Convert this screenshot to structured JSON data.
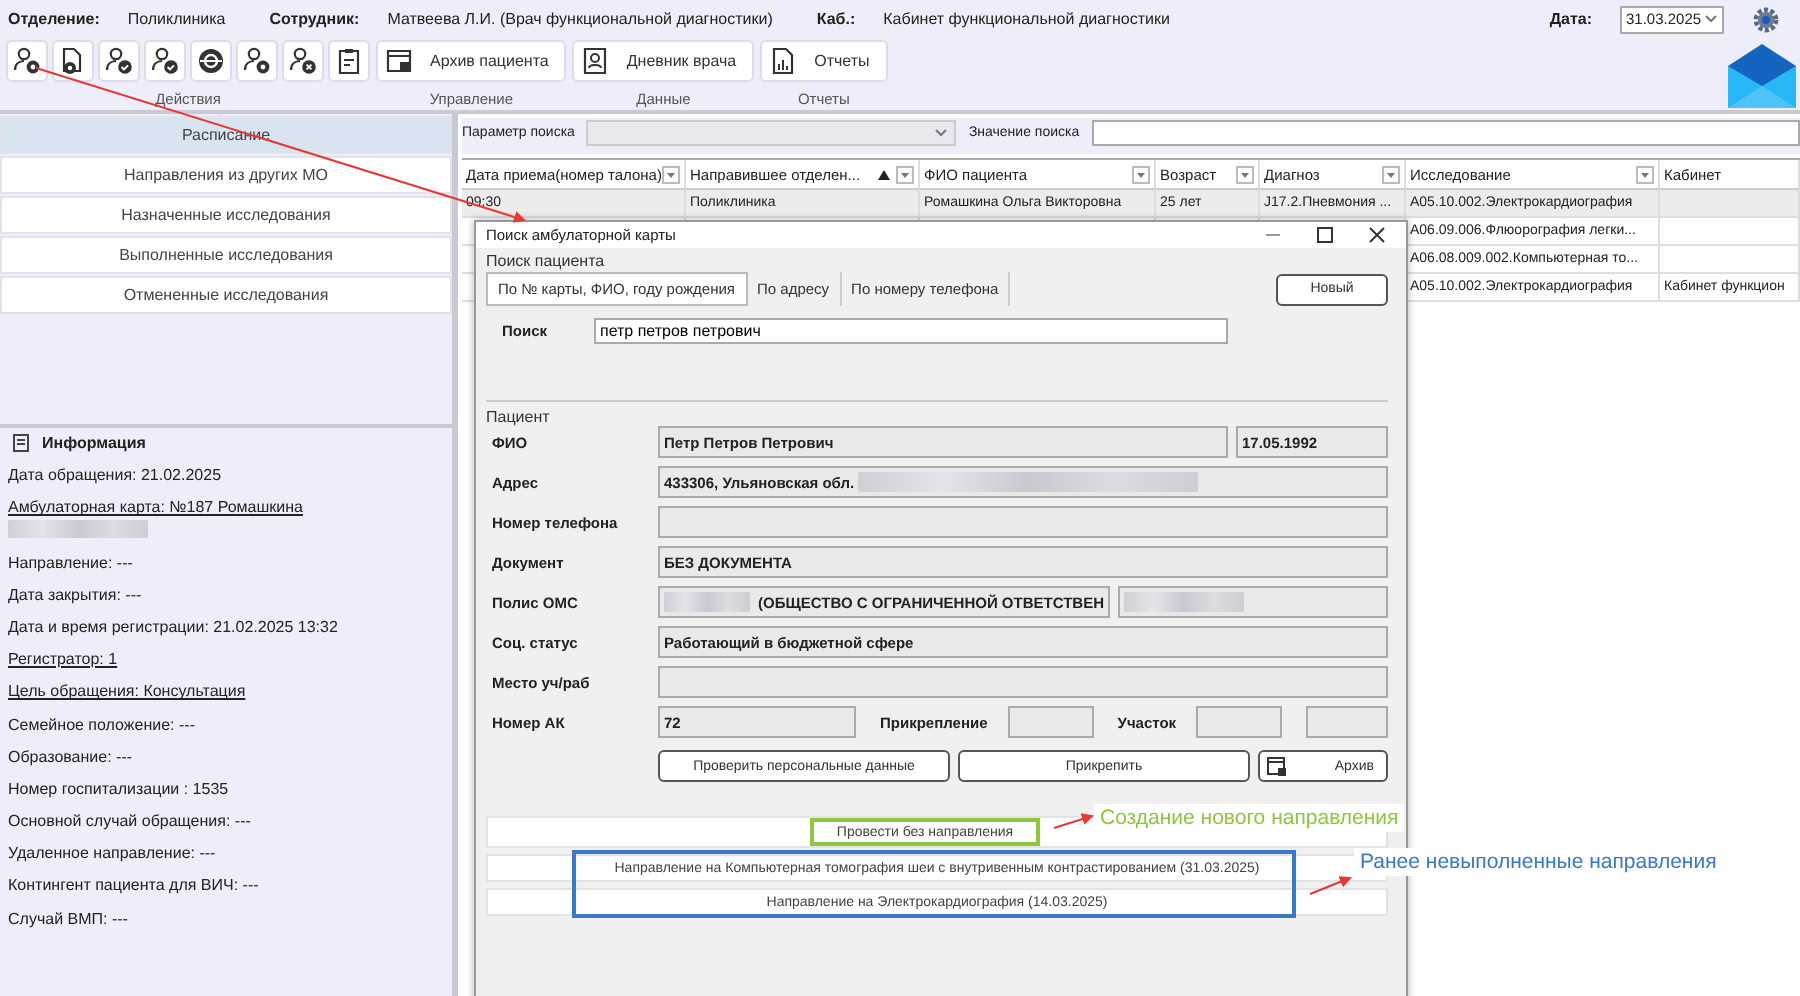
{
  "header": {
    "fields": [
      {
        "label": "Отделение:",
        "value": "Поликлиника"
      },
      {
        "label": "Сотрудник:",
        "value": "Матвеева Л.И. (Врач функциональной диагностики)"
      },
      {
        "label": "Каб.:",
        "value": "Кабинет функциональной диагностики"
      }
    ],
    "date_label": "Дата:",
    "date_value": "31.03.2025"
  },
  "toolbar": [
    {
      "label": "Действия",
      "buttons": [
        {
          "kind": "icon"
        },
        {
          "kind": "icon"
        },
        {
          "kind": "icon"
        },
        {
          "kind": "icon"
        },
        {
          "kind": "icon"
        },
        {
          "kind": "icon"
        },
        {
          "kind": "icon"
        },
        {
          "kind": "icon"
        }
      ]
    },
    {
      "label": "Управление",
      "buttons": [
        {
          "kind": "icon-text",
          "label": "Архив пациента"
        }
      ]
    },
    {
      "label": "Данные",
      "buttons": [
        {
          "kind": "icon-text",
          "label": "Дневник врача"
        }
      ]
    },
    {
      "label": "Отчеты",
      "buttons": [
        {
          "kind": "icon-text",
          "label": "Отчеты"
        }
      ]
    }
  ],
  "sidebar": {
    "items": [
      {
        "label": "Расписание",
        "selected": true
      },
      {
        "label": "Направления из других МО",
        "selected": false
      },
      {
        "label": "Назначенные исследования",
        "selected": false
      },
      {
        "label": "Выполненные исследования",
        "selected": false
      },
      {
        "label": "Отмененные исследования",
        "selected": false
      }
    ]
  },
  "info": {
    "title": "Информация",
    "items": [
      {
        "text": "Дата обращения: 21.02.2025",
        "link": false
      },
      {
        "text": "Амбулаторная карта: №187 Ромашкина",
        "link": true
      },
      {
        "text": "Направление: ---",
        "link": false
      },
      {
        "text": "Дата закрытия: ---",
        "link": false
      },
      {
        "text": "Дата и время регистрации: 21.02.2025 13:32",
        "link": false
      },
      {
        "text": "Регистратор: 1",
        "link": true
      },
      {
        "text": "Цель обращения: Консультация",
        "link": true
      },
      {
        "text": "Семейное положение: ---",
        "link": false
      },
      {
        "text": "Образование: ---",
        "link": false
      },
      {
        "text": "Номер госпитализации : 1535",
        "link": false
      },
      {
        "text": "Основной случай обращения: ---",
        "link": false
      },
      {
        "text": "Удаленное направление: ---",
        "link": false
      },
      {
        "text": "Контингент пациента для ВИЧ: ---",
        "link": false
      },
      {
        "text": "Случай ВМП: ---",
        "link": false
      }
    ]
  },
  "search": {
    "param_label": "Параметр поиска",
    "value_label": "Значение поиска"
  },
  "table": {
    "columns": [
      {
        "label": "Дата приема(номер талона)",
        "sorted": false
      },
      {
        "label": "Направившее  отделен...",
        "sorted": true
      },
      {
        "label": "ФИО пациента",
        "sorted": false
      },
      {
        "label": "Возраст",
        "sorted": false
      },
      {
        "label": "Диагноз",
        "sorted": false
      },
      {
        "label": "Исследование",
        "sorted": false
      },
      {
        "label": "Кабинет",
        "sorted": false
      }
    ],
    "rows": [
      {
        "selected": true,
        "cells": [
          "09:30",
          "Поликлиника",
          "Ромашкина Ольга Викторовна",
          "25 лет",
          "J17.2.Пневмония ...",
          "A05.10.002.Электрокардиография",
          ""
        ]
      },
      {
        "selected": false,
        "cells": [
          "",
          "",
          "",
          "",
          "",
          "A06.09.006.Флюорография  легки...",
          ""
        ]
      },
      {
        "selected": false,
        "cells": [
          "",
          "",
          "",
          "",
          "",
          "A06.08.009.002.Компьютерная  то...",
          ""
        ]
      },
      {
        "selected": false,
        "cells": [
          "",
          "",
          "",
          "",
          "",
          "A05.10.002.Электрокардиография",
          "Кабинет функцион"
        ]
      }
    ]
  },
  "dialog": {
    "title": "Поиск амбулаторной карты",
    "search_group": "Поиск пациента",
    "tabs": [
      {
        "label": "По № карты, ФИО, году рождения",
        "selected": true
      },
      {
        "label": "По адресу",
        "selected": false
      },
      {
        "label": "По номеру телефона",
        "selected": false
      }
    ],
    "new_button": "Новый",
    "search_label": "Поиск",
    "search_value": "петр петров петрович",
    "patient_group": "Пациент",
    "rows": [
      {
        "label": "ФИО",
        "cells": [
          {
            "kind": "field",
            "value": "Петр Петров Петрович"
          },
          {
            "kind": "date",
            "value": "17.05.1992"
          }
        ]
      },
      {
        "label": "Адрес",
        "cells": [
          {
            "kind": "field",
            "value": "433306, Ульяновская обл."
          }
        ]
      },
      {
        "label": "Номер телефона",
        "cells": [
          {
            "kind": "field"
          }
        ]
      },
      {
        "label": "Документ",
        "cells": [
          {
            "kind": "field",
            "value": "БЕЗ ДОКУМЕНТА"
          }
        ]
      },
      {
        "label": "Полис ОМС",
        "cells": [
          {
            "kind": "policy",
            "value": "(ОБЩЕСТВО С ОГРАНИЧЕННОЙ ОТВЕТСТВЕН"
          },
          {
            "kind": "field"
          }
        ]
      },
      {
        "label": "Соц. статус",
        "cells": [
          {
            "kind": "field",
            "value": "Работающий в бюджетной сфере"
          }
        ]
      },
      {
        "label": "Место уч/раб",
        "cells": [
          {
            "kind": "field"
          }
        ]
      },
      {
        "label": "Номер АК",
        "cells": [
          {
            "kind": "ak",
            "value": "72"
          },
          {
            "kind": "label",
            "text": "Прикрепление"
          },
          {
            "kind": "narrow"
          },
          {
            "kind": "label",
            "text": "Участок"
          },
          {
            "kind": "narrow"
          },
          {
            "kind": "field"
          }
        ]
      }
    ],
    "buttons": [
      {
        "kind": "text",
        "label": "Проверить персональные данные"
      },
      {
        "kind": "text",
        "label": "Прикрепить"
      },
      {
        "kind": "icon-text",
        "label": "Архив"
      }
    ],
    "create_button": "Провести без направления",
    "directions": [
      "Направление на Компьютерная томография шеи с внутривенным контрастированием (31.03.2025)",
      "Направление на Электрокардиография (14.03.2025)"
    ]
  },
  "annotations": [
    {
      "text": "Создание нового направления",
      "color": "#8dc63f"
    },
    {
      "text": "Ранее невыполненные направления",
      "color": "#3a78c8"
    }
  ]
}
